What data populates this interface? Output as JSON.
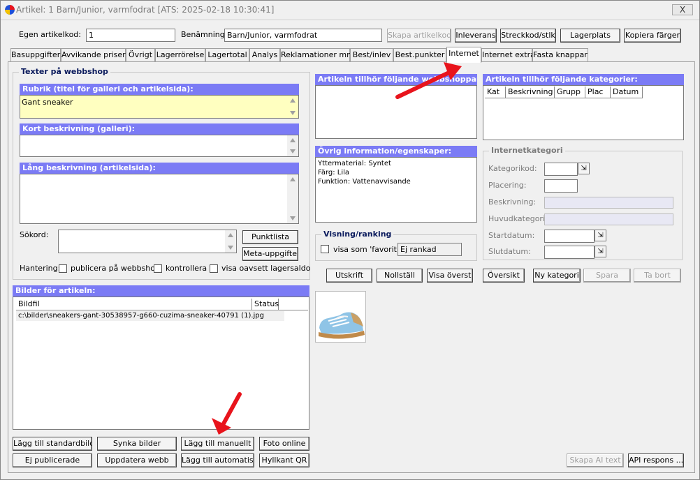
{
  "window": {
    "title": "Artikel: 1  Barn/Junior, varmfodrat [ATS: 2025-02-18 10:30:41]",
    "close": "X"
  },
  "top": {
    "egen_label": "Egen artikelkod:",
    "egen_value": "1",
    "benamning_label": "Benämning:",
    "benamning_value": "Barn/Junior, varmfodrat",
    "buttons": [
      "Skapa artikelkod",
      "Inleverans",
      "Streckkod/stlk",
      "Lagerplats",
      "Kopiera färger"
    ]
  },
  "tabs": [
    "Basuppgifter",
    "Avvikande priser",
    "Övrigt",
    "Lagerrörelse",
    "Lagertotal",
    "Analys",
    "Reklamationer mm",
    "Best/inlev",
    "Best.punkter",
    "Internet",
    "Internet extra",
    "Fasta knappar"
  ],
  "texter": {
    "title": "Texter på webbshop",
    "rubrik_hdr": "Rubrik (titel för galleri och artikelsida):",
    "rubrik_value": "Gant  sneaker",
    "kort_hdr": "Kort beskrivning (galleri):",
    "lang_hdr": "Lång beskrivning (artikelsida):",
    "sokord_label": "Sökord:",
    "punktlista": "Punktlista",
    "meta": "Meta-uppgifter",
    "hantering_label": "Hantering:",
    "publicera": "publicera på webbshop",
    "kontrollera": "kontrollera",
    "visa_oavsett": "visa oavsett lagersaldo"
  },
  "bilder": {
    "hdr": "Bilder för artikeln:",
    "col_bildfil": "Bildfil",
    "col_status": "Status",
    "file": "c:\\bilder\\sneakers-gant-30538957-g660-cuzima-sneaker-40791 (1).jpg",
    "buttons": [
      "Lägg till standardbild",
      "Synka bilder",
      "Lägg till manuellt",
      "Foto online",
      "Ej publicerade",
      "Uppdatera webb",
      "Lägg till automatiskt",
      "Hyllkant QR"
    ]
  },
  "mid": {
    "webbshop_hdr": "Artikeln tillhör följande webbshoppar:",
    "ovrig_hdr": "Övrig information/egenskaper:",
    "ovrig_lines": [
      "Yttermaterial: Syntet",
      "Färg: Lila",
      "Funktion: Vattenavvisande"
    ],
    "visning_title": "Visning/ranking",
    "visa_favorit": "visa som 'favorit'",
    "rank_value": "Ej rankad",
    "buttons": [
      "Utskrift",
      "Nollställ",
      "Visa överst"
    ]
  },
  "right": {
    "kategorier_hdr": "Artikeln tillhör följande kategorier:",
    "cols": [
      "Kat",
      "Beskrivning",
      "Grupp",
      "Plac",
      "Datum"
    ],
    "internetkategori": "Internetkategori",
    "kategorikod": "Kategorikod:",
    "placering": "Placering:",
    "beskrivning": "Beskrivning:",
    "huvudkategori": "Huvudkategori:",
    "startdatum": "Startdatum:",
    "slutdatum": "Slutdatum:",
    "buttons": [
      "Översikt",
      "Ny kategori",
      "Spara",
      "Ta bort"
    ],
    "skapa_ai": "Skapa AI text",
    "api": "API respons ..."
  },
  "colors": {
    "header_blue": "#7b7bf5",
    "highlight": "#ffffc0",
    "annotation_red": "#e8141c"
  }
}
